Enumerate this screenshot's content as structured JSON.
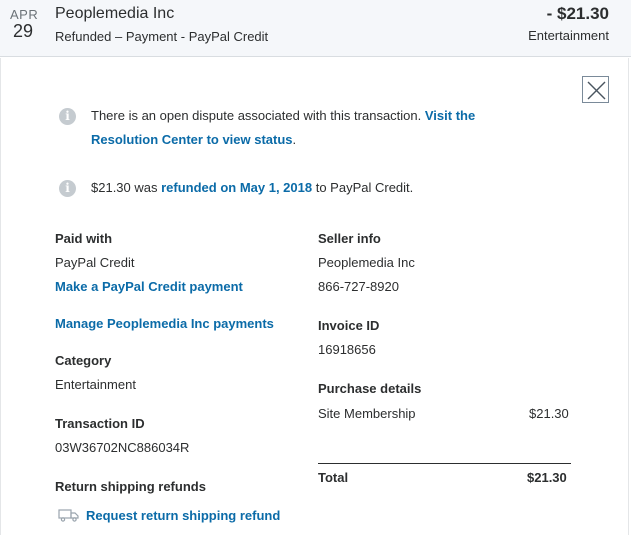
{
  "transaction": {
    "month": "APR",
    "day": "29",
    "merchant": "Peoplemedia Inc",
    "status": "Refunded – Payment - PayPal Credit",
    "amount": "- $21.30",
    "amount_category": "Entertainment"
  },
  "notices": {
    "dispute_text": "There is an open dispute associated with this transaction.",
    "dispute_link": "Visit the Resolution Center to view status",
    "dispute_end": ".",
    "refund_amount": "$21.30",
    "refund_was": " was ",
    "refund_link": "refunded on May 1, 2018",
    "refund_to": " to PayPal Credit."
  },
  "details": {
    "paid_with_label": "Paid with",
    "paid_with_value": "PayPal Credit",
    "make_payment_link": "Make a PayPal Credit payment",
    "manage_payments_link": "Manage Peoplemedia Inc payments",
    "category_label": "Category",
    "category_value": "Entertainment",
    "transaction_id_label": "Transaction ID",
    "transaction_id_value": "03W36702NC886034R",
    "return_shipping_label": "Return shipping refunds",
    "request_refund_link": "Request return shipping refund"
  },
  "seller": {
    "label": "Seller info",
    "name": "Peoplemedia Inc",
    "phone": "866-727-8920",
    "invoice_label": "Invoice ID",
    "invoice_value": "16918656",
    "purchase_label": "Purchase details",
    "item_name": "Site Membership",
    "item_amount": "$21.30",
    "total_label": "Total",
    "total_amount": "$21.30"
  },
  "icons": {
    "close": "close-icon",
    "info": "info-icon",
    "truck": "truck-icon"
  },
  "colors": {
    "link": "#0b6ba8",
    "header_bg": "#f5f7fa",
    "info_icon": "#c5cbd0"
  }
}
